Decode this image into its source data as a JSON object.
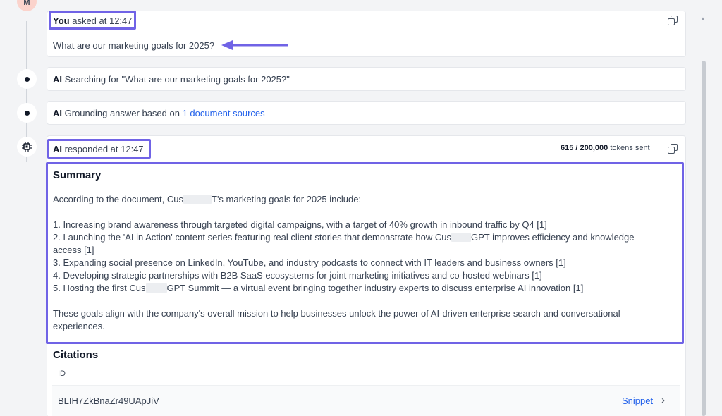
{
  "avatar": {
    "initial": "M"
  },
  "question": {
    "who": "You",
    "asked_label": "asked at 12:47",
    "text": "What are our marketing goals for 2025?"
  },
  "search_step": {
    "who": "AI",
    "text": "Searching for \"What are our marketing goals for 2025?\""
  },
  "ground_step": {
    "who": "AI",
    "text": "Grounding answer based on",
    "link": "1 document sources"
  },
  "response": {
    "who": "AI",
    "label": "responded at 12:47",
    "tokens_count": "615 / 200,000",
    "tokens_suffix": "tokens sent",
    "summary_title": "Summary",
    "intro_a": "According to the document, Cus",
    "intro_b": "T's marketing goals for 2025 include:",
    "goal1": "1. Increasing brand awareness through targeted digital campaigns, with a target of 40% growth in inbound traffic by Q4 [1]",
    "goal2_a": "2. Launching the 'AI in Action' content series featuring real client stories that demonstrate how Cus",
    "goal2_b": "GPT improves efficiency and knowledge",
    "goal2_c": "access [1]",
    "goal3": "3. Expanding social presence on LinkedIn, YouTube, and industry podcasts to connect with IT leaders and business owners [1]",
    "goal4": "4. Developing strategic partnerships with B2B SaaS ecosystems for joint marketing initiatives and co-hosted webinars [1]",
    "goal5_a": "5. Hosting the first Cus",
    "goal5_b": "GPT Summit — a virtual event bringing together industry experts to discuss enterprise AI innovation [1]",
    "closing": "These goals align with the company's overall mission to help businesses unlock the power of AI-driven enterprise search and conversational experiences."
  },
  "citations": {
    "title": "Citations",
    "id_header": "ID",
    "rows": [
      {
        "id": "BLIH7ZkBnaZr49UApJiV",
        "action": "Snippet"
      }
    ]
  },
  "colors": {
    "highlight": "#7063e6",
    "link": "#2563eb"
  }
}
